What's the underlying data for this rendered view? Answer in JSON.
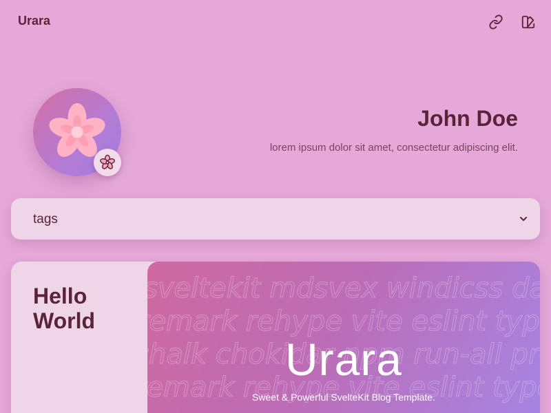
{
  "header": {
    "site_title": "Urara",
    "icons": [
      "link-icon",
      "theme-icon"
    ]
  },
  "profile": {
    "name": "John Doe",
    "bio": "lorem ipsum dolor sit amet, consectetur adipiscing elit.",
    "avatar_icon": "cherry-blossom-icon",
    "badge_icon": "cherry-blossom-icon"
  },
  "tags": {
    "label": "tags",
    "icon": "chevron-down-icon"
  },
  "post": {
    "title": "Hello World",
    "cover": {
      "title": "Urara",
      "subtitle": "Sweet & Powerful SvelteKit Blog Template.",
      "background_lines": [
        "sveltekit mdsvex windicss daisy",
        "remark rehype vite eslint typesc",
        "chalk chokidar npm run-all pre",
        "remark rehype vite eslint typescri"
      ]
    }
  },
  "colors": {
    "background": "#e5a8d8",
    "surface": "#efd5e8",
    "text": "#5a2338",
    "accent_pink": "#cf6aa0",
    "accent_purple": "#a585e4"
  }
}
